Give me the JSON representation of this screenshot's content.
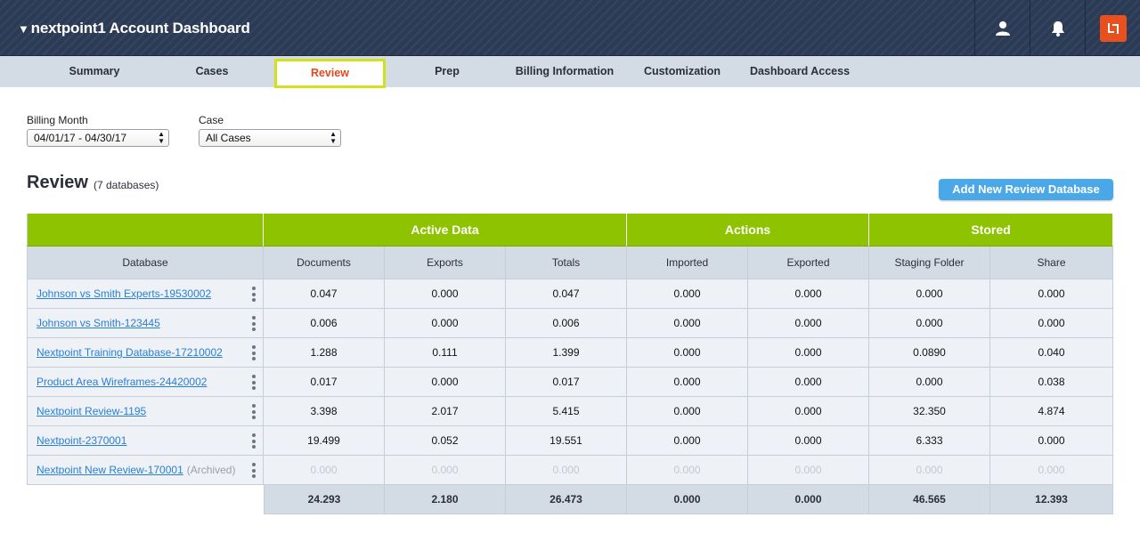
{
  "header": {
    "caret": "▼",
    "title": "nextpoint1 Account Dashboard",
    "icons": [
      "user-icon",
      "bell-icon",
      "nextpoint-logo-icon"
    ],
    "logo_color": "#e8501f"
  },
  "nav": {
    "items": [
      "Summary",
      "Cases",
      "Review",
      "Prep",
      "Billing Information",
      "Customization",
      "Dashboard Access"
    ],
    "active": "Review"
  },
  "filters": {
    "billing_month_label": "Billing Month",
    "billing_month_value": "04/01/17 - 04/30/17",
    "case_label": "Case",
    "case_value": "All Cases"
  },
  "section": {
    "title": "Review",
    "count": "(7 databases)",
    "add_button": "Add New Review Database"
  },
  "table": {
    "groups": [
      "Active Data",
      "Actions",
      "Stored"
    ],
    "columns": [
      "Database",
      "Documents",
      "Exports",
      "Totals",
      "Imported",
      "Exported",
      "Staging Folder",
      "Share"
    ],
    "rows": [
      {
        "name": "Johnson vs Smith Experts-19530002",
        "archived": "",
        "values": [
          "0.047",
          "0.000",
          "0.047",
          "0.000",
          "0.000",
          "0.000",
          "0.000"
        ]
      },
      {
        "name": "Johnson vs Smith-123445",
        "archived": "",
        "values": [
          "0.006",
          "0.000",
          "0.006",
          "0.000",
          "0.000",
          "0.000",
          "0.000"
        ]
      },
      {
        "name": "Nextpoint Training Database-17210002",
        "archived": "",
        "values": [
          "1.288",
          "0.111",
          "1.399",
          "0.000",
          "0.000",
          "0.0890",
          "0.040"
        ]
      },
      {
        "name": "Product Area Wireframes-24420002",
        "archived": "",
        "values": [
          "0.017",
          "0.000",
          "0.017",
          "0.000",
          "0.000",
          "0.000",
          "0.038"
        ]
      },
      {
        "name": "Nextpoint Review-1195",
        "archived": "",
        "values": [
          "3.398",
          "2.017",
          "5.415",
          "0.000",
          "0.000",
          "32.350",
          "4.874"
        ]
      },
      {
        "name": "Nextpoint-2370001",
        "archived": "",
        "values": [
          "19.499",
          "0.052",
          "19.551",
          "0.000",
          "0.000",
          "6.333",
          "0.000"
        ]
      },
      {
        "name": "Nextpoint New Review-170001",
        "archived": "(Archived)",
        "values": [
          "0.000",
          "0.000",
          "0.000",
          "0.000",
          "0.000",
          "0.000",
          "0.000"
        ]
      }
    ],
    "totals": [
      "24.293",
      "2.180",
      "26.473",
      "0.000",
      "0.000",
      "46.565",
      "12.393"
    ]
  },
  "colors": {
    "topbar": "#2b3a55",
    "group_header": "#8dc300",
    "link": "#2a7ed3",
    "active_nav_text": "#e24a1c",
    "active_nav_border": "#d4e01c",
    "button": "#4aa8e8"
  }
}
